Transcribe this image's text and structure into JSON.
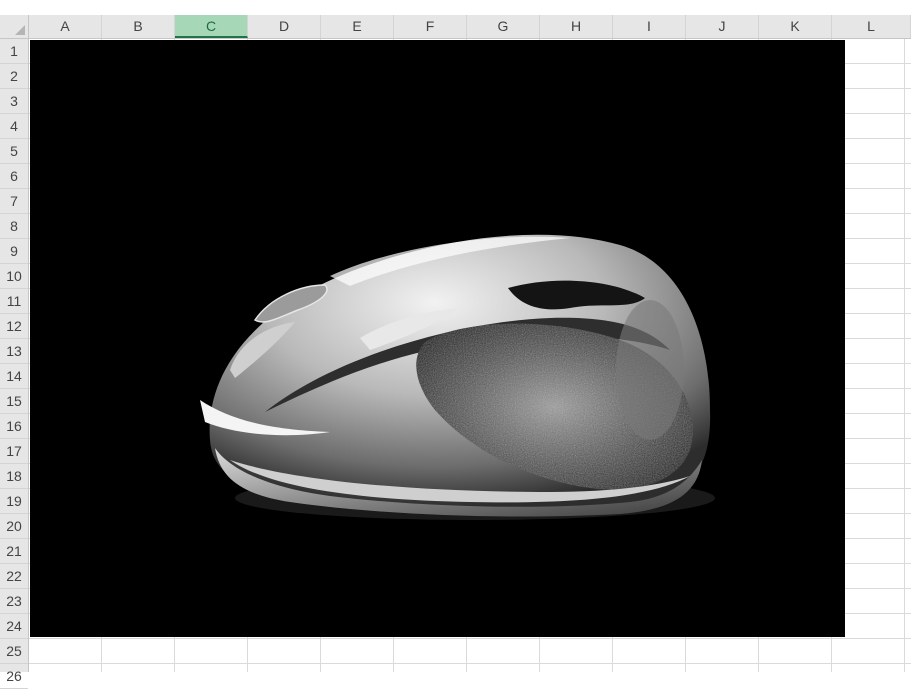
{
  "spreadsheet": {
    "columns": [
      "A",
      "B",
      "C",
      "D",
      "E",
      "F",
      "G",
      "H",
      "I",
      "J",
      "K",
      "L"
    ],
    "selected_column": "C",
    "rows": [
      "1",
      "2",
      "3",
      "4",
      "5",
      "6",
      "7",
      "8",
      "9",
      "10",
      "11",
      "12",
      "13",
      "14",
      "15",
      "16",
      "17",
      "18",
      "19",
      "20",
      "21",
      "22",
      "23",
      "24",
      "25",
      "26"
    ]
  },
  "embedded_image": {
    "subject": "computer-mouse",
    "background_color": "#000000"
  },
  "colors": {
    "header_bg": "#e6e6e6",
    "selected_header_bg": "#a6d8b8",
    "gridline": "#dadada"
  }
}
